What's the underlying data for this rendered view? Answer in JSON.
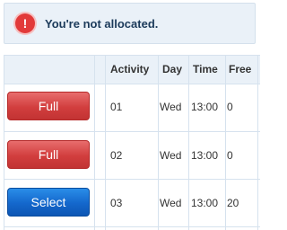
{
  "alert": {
    "icon": "exclamation-icon",
    "icon_glyph": "!",
    "message": "You're not allocated."
  },
  "table": {
    "headers": [
      "",
      "",
      "Activity",
      "Day",
      "Time",
      "Free"
    ],
    "rows": [
      {
        "button": "Full",
        "button_state": "full",
        "activity": "01",
        "day": "Wed",
        "time": "13:00",
        "free": "0"
      },
      {
        "button": "Full",
        "button_state": "full",
        "activity": "02",
        "day": "Wed",
        "time": "13:00",
        "free": "0"
      },
      {
        "button": "Select",
        "button_state": "select",
        "activity": "03",
        "day": "Wed",
        "time": "13:00",
        "free": "20"
      }
    ]
  },
  "colors": {
    "full_button": "#d23e3e",
    "select_button": "#1467cc",
    "alert_icon": "#e23a3a",
    "header_bg": "#eaf1f8"
  }
}
